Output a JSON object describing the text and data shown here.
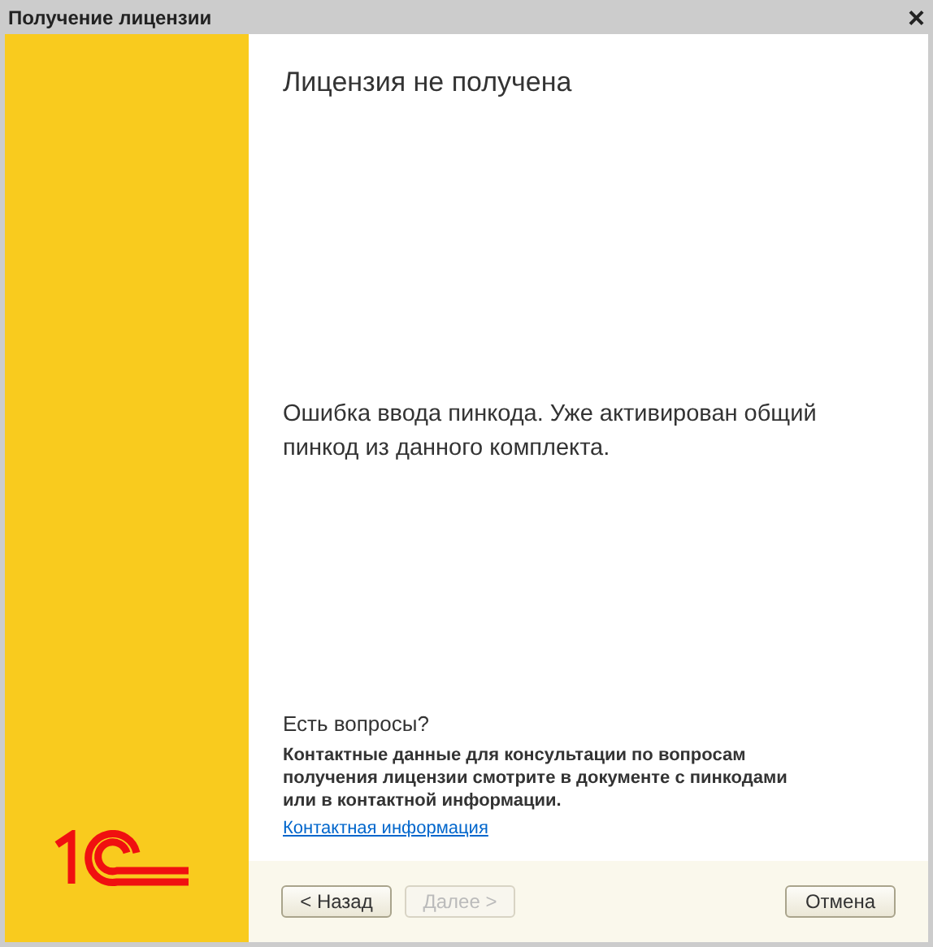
{
  "window": {
    "title": "Получение лицензии",
    "close": "×"
  },
  "heading": "Лицензия не получена",
  "message": "Ошибка ввода пинкода. Уже активирован общий пинкод из данного комплекта.",
  "help": {
    "title": "Есть вопросы?",
    "text": "Контактные данные для консультации по вопросам получения лицензии смотрите в документе с пинкодами или в контактной информации.",
    "link": "Контактная информация"
  },
  "nav_buttons": [
    {
      "label": "< Назад",
      "disabled": false
    },
    {
      "label": "Далее >",
      "disabled": true
    }
  ],
  "cancel_button": {
    "label": "Отмена",
    "disabled": false
  }
}
